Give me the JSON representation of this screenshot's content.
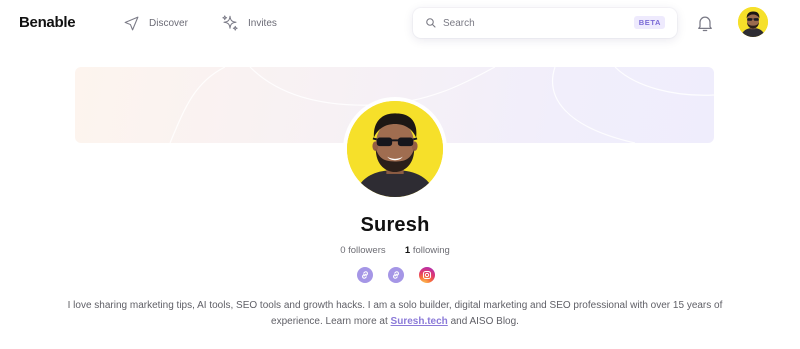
{
  "app": {
    "logo": "Benable"
  },
  "nav": {
    "discover_label": "Discover",
    "invites_label": "Invites"
  },
  "search": {
    "placeholder": "Search",
    "badge": "BETA"
  },
  "icons": {
    "discover": "navigation-arrow-icon",
    "invites": "sparkles-icon",
    "search": "search-icon",
    "notifications": "bell-icon",
    "social_1": "link-icon",
    "social_2": "link-icon",
    "social_3": "instagram-icon"
  },
  "colors": {
    "accent": "#8b7ad8",
    "avatar_bg": "#f6e02a",
    "banner_start": "#fdf4ee",
    "banner_end": "#efedfc"
  },
  "profile": {
    "name": "Suresh",
    "followers_count": "0",
    "followers_label": "followers",
    "following_count": "1",
    "following_label": "following",
    "bio_before": "I love sharing marketing tips, AI tools, SEO tools and growth hacks. I am a solo builder, digital marketing and SEO professional with over 15 years of experience. Learn more at ",
    "bio_link": "Suresh.tech",
    "bio_after": " and AISO Blog."
  }
}
